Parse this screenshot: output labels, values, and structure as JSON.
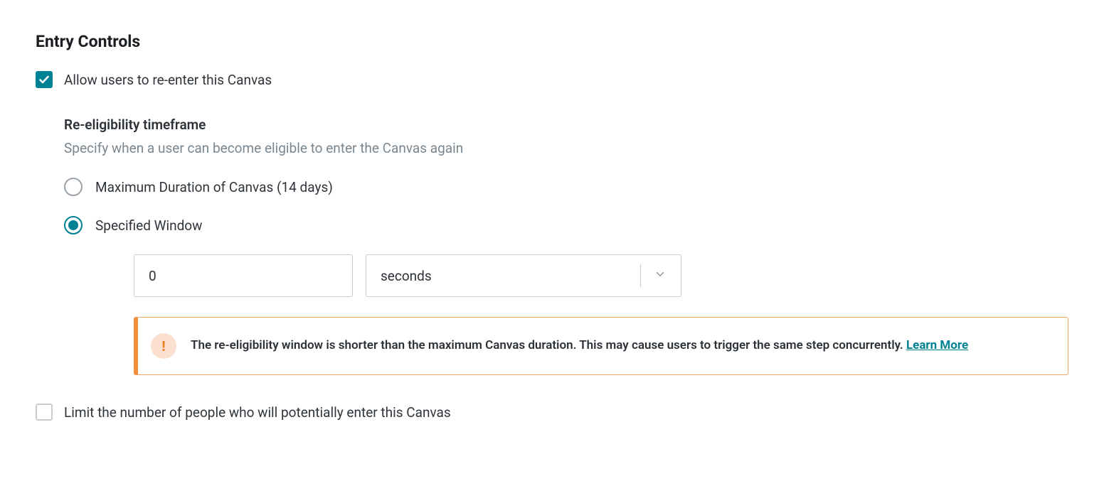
{
  "section": {
    "title": "Entry Controls"
  },
  "allow_reenter": {
    "label": "Allow users to re-enter this Canvas",
    "checked": true
  },
  "re_eligibility": {
    "title": "Re-eligibility timeframe",
    "description": "Specify when a user can become eligible to enter the Canvas again",
    "options": {
      "max_duration": {
        "label": "Maximum Duration of Canvas (14 days)",
        "selected": false
      },
      "specified_window": {
        "label": "Specified Window",
        "selected": true,
        "value": "0",
        "unit": "seconds"
      }
    }
  },
  "warning": {
    "text": "The re-eligibility window is shorter than the maximum Canvas duration. This may cause users to trigger the same step concurrently.",
    "link_label": "Learn More"
  },
  "limit": {
    "label": "Limit the number of people who will potentially enter this Canvas",
    "checked": false
  }
}
